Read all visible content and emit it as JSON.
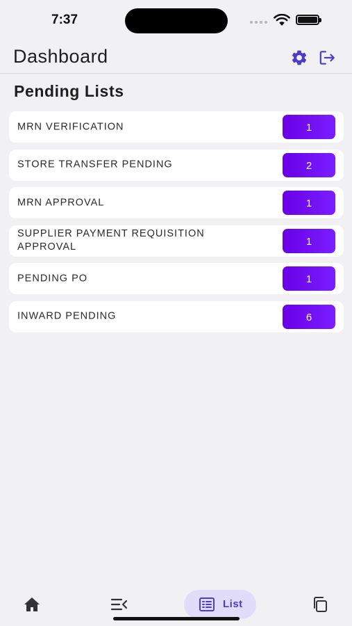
{
  "status_bar": {
    "time": "7:37"
  },
  "app_bar": {
    "title": "Dashboard",
    "settings_icon": "gear-icon",
    "logout_icon": "logout-icon",
    "accent_color": "#4b3cc8"
  },
  "section": {
    "title": "Pending Lists"
  },
  "pending_items": [
    {
      "label": "MRN VERIFICATION",
      "count": "1"
    },
    {
      "label": "STORE TRANSFER PENDING",
      "count": "2"
    },
    {
      "label": "MRN APPROVAL",
      "count": "1"
    },
    {
      "label": "SUPPLIER PAYMENT REQUISITION APPROVAL",
      "count": "1"
    },
    {
      "label": "PENDING PO",
      "count": "1"
    },
    {
      "label": "INWARD PENDING",
      "count": "6"
    }
  ],
  "badge_colors": {
    "start": "#6a00e6",
    "end": "#7a1fff"
  },
  "bottom_nav": {
    "home_icon": "home-icon",
    "menu_icon": "menu-collapse-icon",
    "list_label": "List",
    "list_icon": "list-icon",
    "copy_icon": "copy-icon",
    "active_bg": "#e0dcfa"
  }
}
